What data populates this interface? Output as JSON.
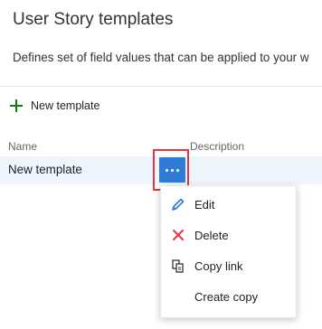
{
  "page": {
    "title": "User Story templates",
    "subtitle": "Defines set of field values that can be applied to your w"
  },
  "toolbar": {
    "new_template_label": "New template",
    "new_template_icon": "plus-icon",
    "accent_color": "#107c10"
  },
  "table": {
    "columns": [
      "Name",
      "Description"
    ],
    "rows": [
      {
        "name": "New template",
        "description": ""
      }
    ],
    "row_highlight_color": "#eef5fc"
  },
  "row_actions": {
    "more_icon": "more-dots-icon",
    "button_color": "#2f7cd6",
    "highlight_color": "#e8343c"
  },
  "context_menu": {
    "items": [
      {
        "label": "Edit",
        "icon": "pencil-icon"
      },
      {
        "label": "Delete",
        "icon": "x-icon"
      },
      {
        "label": "Copy link",
        "icon": "copy-link-icon"
      },
      {
        "label": "Create copy",
        "icon": ""
      }
    ]
  }
}
